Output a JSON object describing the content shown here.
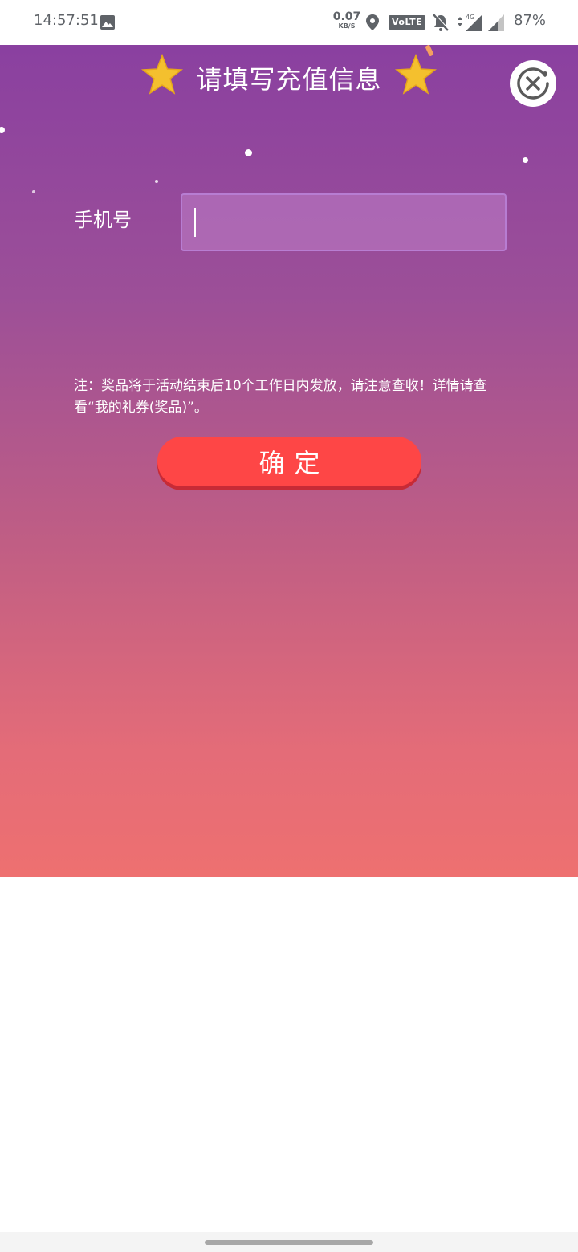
{
  "status_bar": {
    "time": "14:57:51",
    "net_speed_value": "0.07",
    "net_speed_unit": "KB/S",
    "volte": "VoLTE",
    "signal_type": "4G",
    "battery": "87%",
    "icons": [
      "gallery-icon",
      "location-icon",
      "mute-icon",
      "signal-icon",
      "signal-icon"
    ]
  },
  "dialog": {
    "title": "请填写充值信息",
    "phone_label": "手机号",
    "phone_value": "",
    "notice": "注：奖品将于活动结束后10个工作日内发放，请注意查收！详情请查看“我的礼券(奖品)”。",
    "confirm_label": "确定",
    "colors": {
      "gradient_top": "#8a40a0",
      "gradient_bottom": "#ee7070",
      "confirm_button": "#fe4646",
      "star": "#f4c02e"
    }
  }
}
